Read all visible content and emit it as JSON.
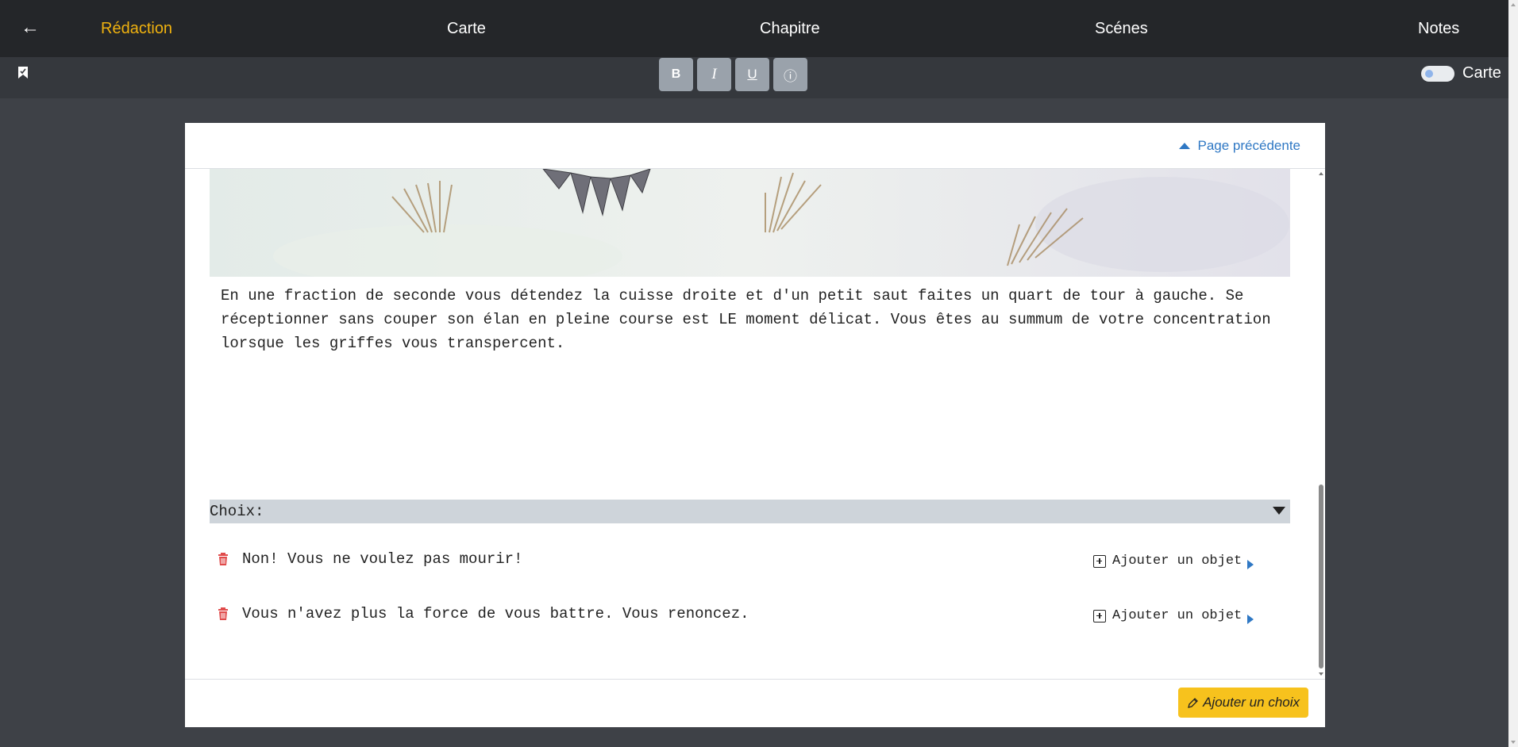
{
  "nav": {
    "back_icon": "arrow-left-icon",
    "items": [
      {
        "label": "Rédaction",
        "active": true
      },
      {
        "label": "Carte",
        "active": false
      },
      {
        "label": "Chapitre",
        "active": false
      },
      {
        "label": "Scénes",
        "active": false
      },
      {
        "label": "Notes",
        "active": false
      }
    ],
    "active_color": "#f0b20f",
    "background": "#242629"
  },
  "toolbar": {
    "bookmark_icon": "bookmark-icon",
    "format_buttons": [
      {
        "label": "B",
        "icon": "bold-icon"
      },
      {
        "label": "I",
        "icon": "italic-icon"
      },
      {
        "label": "U",
        "icon": "underline-icon"
      },
      {
        "label": "ⓘ",
        "icon": "info-icon"
      }
    ],
    "toggle_label": "Carte",
    "toggle_on": false
  },
  "editor": {
    "prev_page_label": "Page précédente",
    "story_text": "En une fraction de seconde vous détendez la cuisse droite et d'un petit saut faites un quart de tour à gauche. Se réceptionner sans couper son élan en pleine course est LE moment délicat. Vous êtes au summum de votre concentration lorsque les griffes vous transpercent.",
    "choices_header": "Choix:",
    "choices": [
      {
        "text": "Non! Vous ne voulez pas mourir!",
        "add_object_label": "Ajouter un objet"
      },
      {
        "text": "Vous n'avez plus la force de vous battre. Vous renoncez.",
        "add_object_label": "Ajouter un objet"
      }
    ],
    "add_choice_label": "Ajouter un choix",
    "add_choice_icon": "pencil-icon",
    "link_color": "#2f78c4",
    "delete_color": "#e04b4b",
    "accent_button_color": "#f7c21d"
  }
}
